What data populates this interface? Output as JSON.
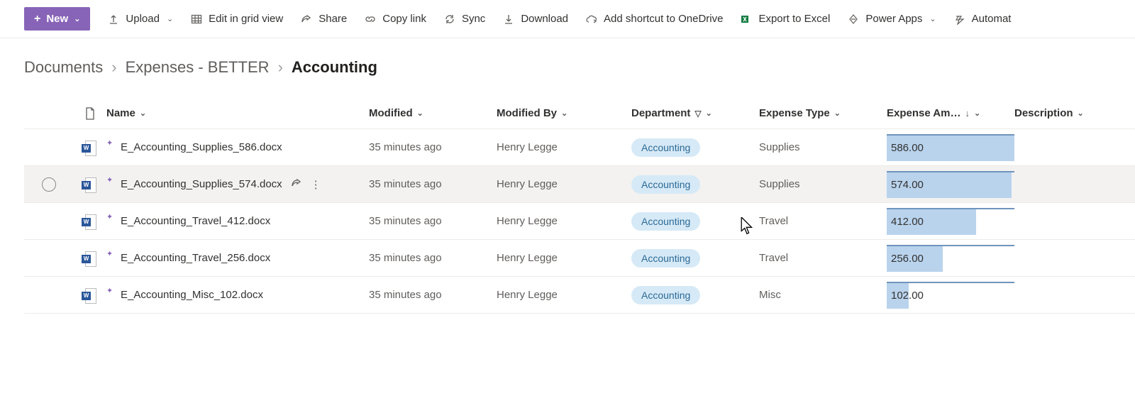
{
  "commandbar": {
    "new_label": "New",
    "upload": "Upload",
    "edit_grid": "Edit in grid view",
    "share": "Share",
    "copy_link": "Copy link",
    "sync": "Sync",
    "download": "Download",
    "add_shortcut": "Add shortcut to OneDrive",
    "export_excel": "Export to Excel",
    "power_apps": "Power Apps",
    "automate": "Automat"
  },
  "breadcrumb": {
    "root": "Documents",
    "mid": "Expenses - BETTER",
    "current": "Accounting"
  },
  "columns": {
    "name": "Name",
    "modified": "Modified",
    "modified_by": "Modified By",
    "department": "Department",
    "expense_type": "Expense Type",
    "expense_amount": "Expense Am…",
    "description": "Description"
  },
  "max_amount": 586.0,
  "rows": [
    {
      "name": "E_Accounting_Supplies_586.docx",
      "modified": "35 minutes ago",
      "modified_by": "Henry Legge",
      "department": "Accounting",
      "expense_type": "Supplies",
      "amount": "586.00",
      "amount_num": 586.0
    },
    {
      "name": "E_Accounting_Supplies_574.docx",
      "modified": "35 minutes ago",
      "modified_by": "Henry Legge",
      "department": "Accounting",
      "expense_type": "Supplies",
      "amount": "574.00",
      "amount_num": 574.0,
      "hover": true
    },
    {
      "name": "E_Accounting_Travel_412.docx",
      "modified": "35 minutes ago",
      "modified_by": "Henry Legge",
      "department": "Accounting",
      "expense_type": "Travel",
      "amount": "412.00",
      "amount_num": 412.0
    },
    {
      "name": "E_Accounting_Travel_256.docx",
      "modified": "35 minutes ago",
      "modified_by": "Henry Legge",
      "department": "Accounting",
      "expense_type": "Travel",
      "amount": "256.00",
      "amount_num": 256.0
    },
    {
      "name": "E_Accounting_Misc_102.docx",
      "modified": "35 minutes ago",
      "modified_by": "Henry Legge",
      "department": "Accounting",
      "expense_type": "Misc",
      "amount": "102.00",
      "amount_num": 102.0
    }
  ]
}
